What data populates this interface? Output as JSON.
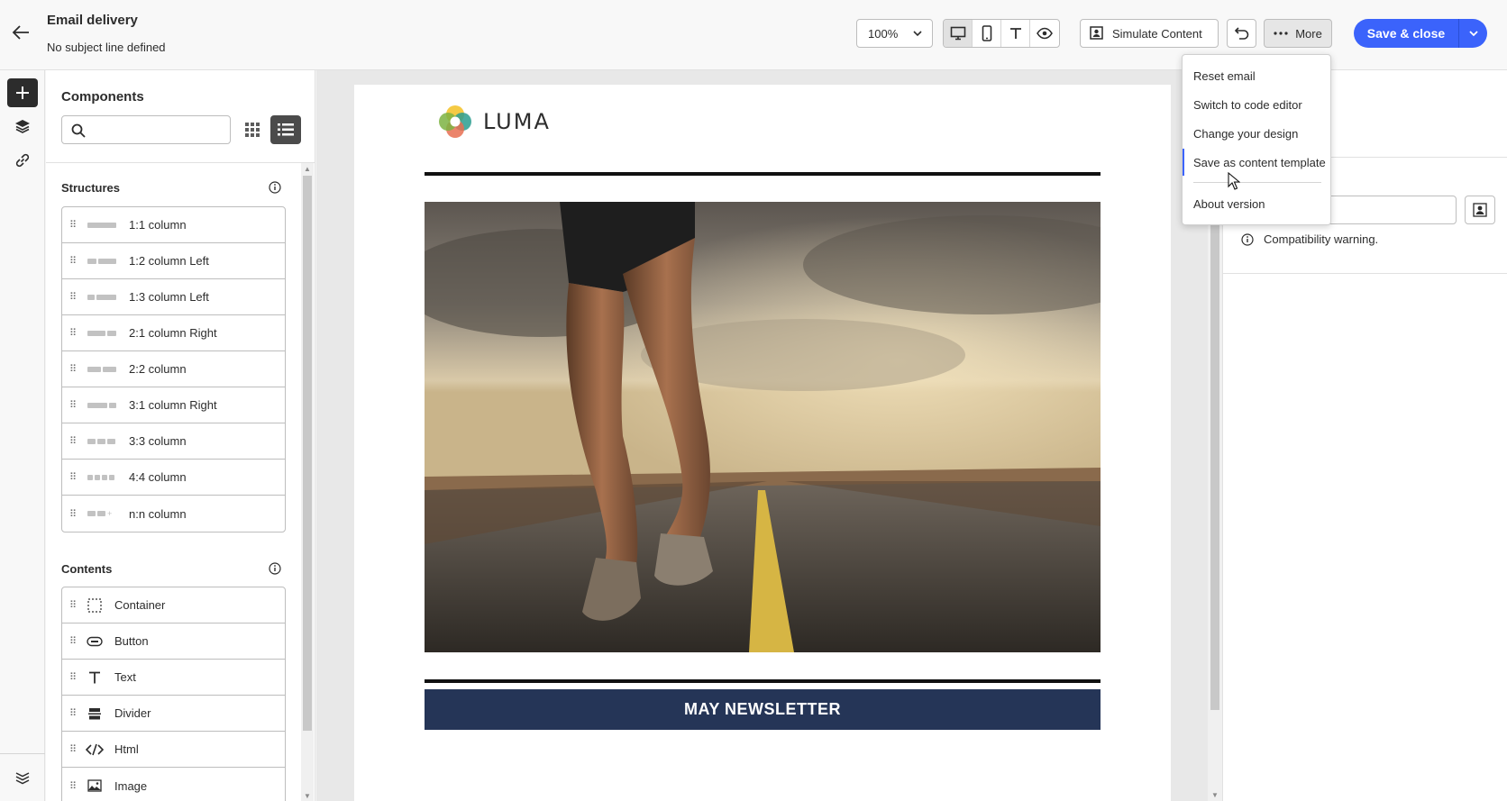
{
  "header": {
    "title": "Email delivery",
    "subtitle": "No subject line defined",
    "zoom": "100%",
    "simulate_label": "Simulate Content",
    "more_label": "More",
    "save_label": "Save & close"
  },
  "menu": {
    "items": [
      "Reset email",
      "Switch to code editor",
      "Change your design",
      "Save as content template",
      "About version"
    ]
  },
  "components": {
    "title": "Components",
    "search_placeholder": "",
    "structures_title": "Structures",
    "structures": [
      "1:1 column",
      "1:2 column Left",
      "1:3 column Left",
      "2:1 column Right",
      "2:2 column",
      "3:1 column Right",
      "3:3 column",
      "4:4 column",
      "n:n column"
    ],
    "contents_title": "Contents",
    "contents": [
      "Container",
      "Button",
      "Text",
      "Divider",
      "Html",
      "Image"
    ]
  },
  "email": {
    "logo_text": "LUMA",
    "banner_text": "MAY NEWSLETTER"
  },
  "right_panel": {
    "warning": "Compatibility warning."
  },
  "colors": {
    "accent": "#3b63fb",
    "banner": "#253557"
  }
}
